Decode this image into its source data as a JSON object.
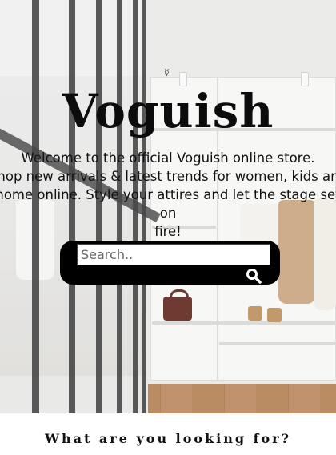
{
  "hero": {
    "brand": "Voguish",
    "tagline_lines": [
      "Welcome to the official Voguish online store.",
      "Shop new arrivals & latest trends for women, kids and",
      "home online.  Style your attires and let the stage set on",
      "fire!"
    ]
  },
  "search": {
    "placeholder": "Search..",
    "value": "",
    "button_icon": "search-icon"
  },
  "section": {
    "title": "What are you looking for?"
  }
}
